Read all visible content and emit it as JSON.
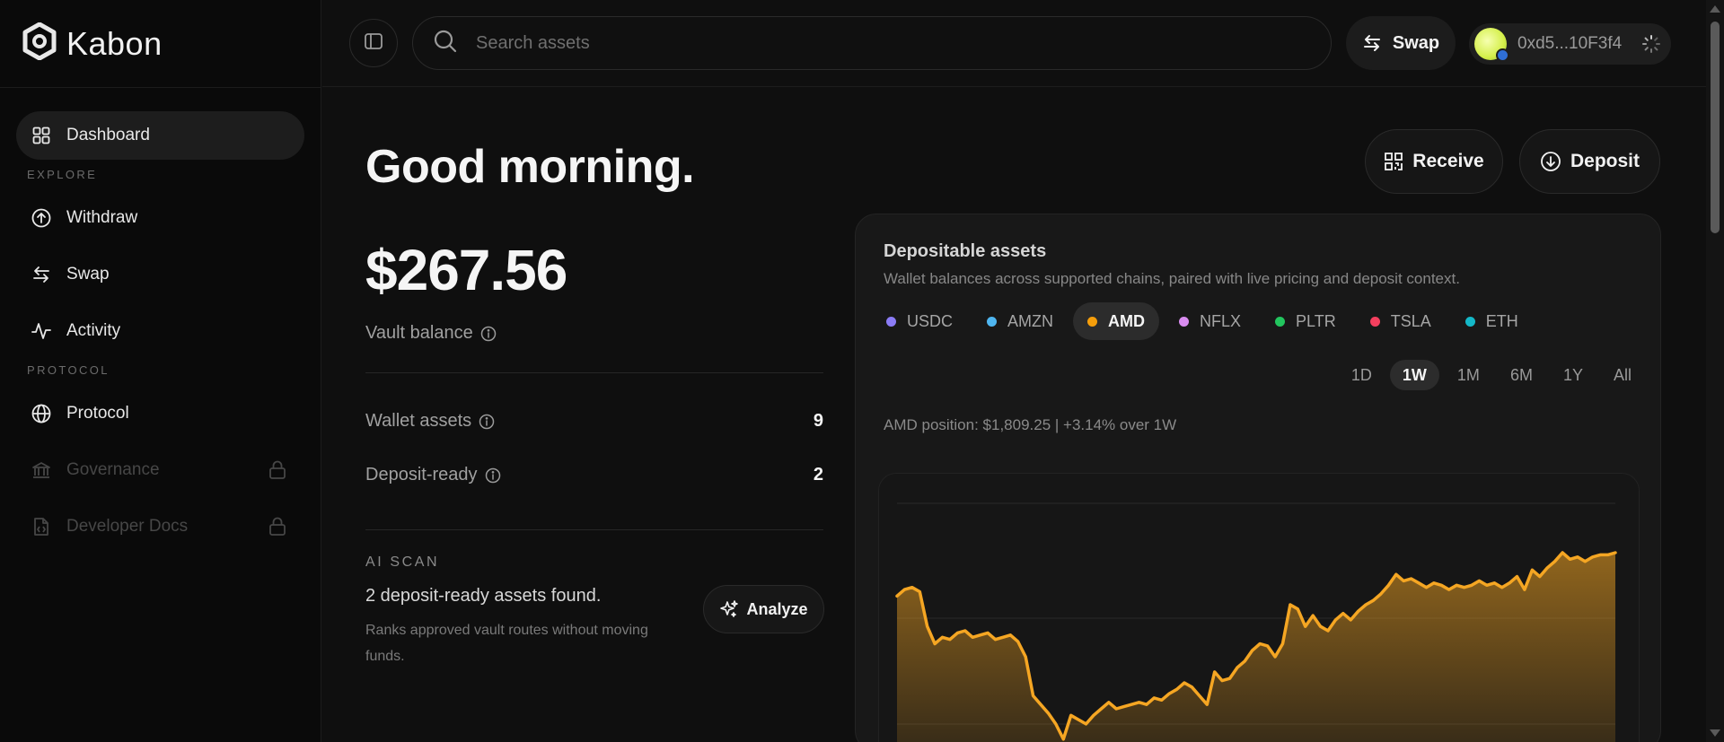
{
  "brand": {
    "name": "Kabon",
    "icon": "kabon-logo-icon"
  },
  "sidebar": {
    "primary": [
      {
        "label": "Dashboard",
        "icon": "grid-icon",
        "active": true
      }
    ],
    "sections": [
      {
        "label": "EXPLORE",
        "items": [
          {
            "label": "Withdraw",
            "icon": "arrow-up-circle-icon"
          },
          {
            "label": "Swap",
            "icon": "swap-arrows-icon"
          },
          {
            "label": "Activity",
            "icon": "activity-pulse-icon"
          }
        ]
      },
      {
        "label": "PROTOCOL",
        "items": [
          {
            "label": "Protocol",
            "icon": "globe-icon"
          },
          {
            "label": "Governance",
            "icon": "bank-icon",
            "disabled": true,
            "locked": true
          },
          {
            "label": "Developer Docs",
            "icon": "code-file-icon",
            "disabled": true,
            "locked": true
          }
        ]
      }
    ]
  },
  "topbar": {
    "search_placeholder": "Search assets",
    "swap_label": "Swap",
    "wallet_address": "0xd5...10F3f4"
  },
  "main": {
    "greeting": "Good morning.",
    "receive_label": "Receive",
    "deposit_label": "Deposit",
    "balance": "$267.56",
    "balance_label": "Vault balance",
    "stats": [
      {
        "label": "Wallet assets",
        "value": "9"
      },
      {
        "label": "Deposit-ready",
        "value": "2"
      }
    ],
    "ai_scan": {
      "label": "AI SCAN",
      "title": "2 deposit-ready assets found.",
      "description": "Ranks approved vault routes without moving funds.",
      "button": "Analyze"
    }
  },
  "card": {
    "title": "Depositable assets",
    "subtitle": "Wallet balances across supported chains, paired with live pricing and deposit context.",
    "assets": [
      {
        "label": "USDC",
        "color": "#8b7cf6"
      },
      {
        "label": "AMZN",
        "color": "#4fb6f0"
      },
      {
        "label": "AMD",
        "color": "#f59e0b",
        "active": true
      },
      {
        "label": "NFLX",
        "color": "#d98cf0"
      },
      {
        "label": "PLTR",
        "color": "#22c55e"
      },
      {
        "label": "TSLA",
        "color": "#f43f5e"
      },
      {
        "label": "ETH",
        "color": "#14b8c8"
      }
    ],
    "ranges": [
      "1D",
      "1W",
      "1M",
      "6M",
      "1Y",
      "All"
    ],
    "active_range": "1W",
    "position_text": "AMD position: $1,809.25 | +3.14% over 1W",
    "line_color": "#f5a623"
  },
  "chart_data": {
    "type": "area",
    "series": [
      {
        "values": [
          3.3,
          3.45,
          3.5,
          3.4,
          2.6,
          2.2,
          2.35,
          2.3,
          2.45,
          2.5,
          2.35,
          2.4,
          2.45,
          2.3,
          2.35,
          2.4,
          2.25,
          1.9,
          1.0,
          0.8,
          0.6,
          0.35,
          0.0,
          0.55,
          0.45,
          0.35,
          0.55,
          0.7,
          0.85,
          0.7,
          0.75,
          0.8,
          0.85,
          0.8,
          0.95,
          0.9,
          1.05,
          1.15,
          1.3,
          1.2,
          1.0,
          0.8,
          1.55,
          1.35,
          1.4,
          1.65,
          1.8,
          2.05,
          2.2,
          2.15,
          1.9,
          2.2,
          3.1,
          3.0,
          2.6,
          2.85,
          2.6,
          2.5,
          2.75,
          2.9,
          2.75,
          2.95,
          3.1,
          3.2,
          3.35,
          3.55,
          3.8,
          3.65,
          3.7,
          3.6,
          3.5,
          3.6,
          3.55,
          3.45,
          3.55,
          3.5,
          3.55,
          3.65,
          3.55,
          3.6,
          3.5,
          3.6,
          3.75,
          3.45,
          3.9,
          3.75,
          3.95,
          4.1,
          4.3,
          4.15,
          4.2,
          4.1,
          4.2,
          4.25,
          4.25,
          4.3
        ]
      }
    ],
    "ylim": [
      -0.5,
      5.5
    ],
    "grid": true
  }
}
